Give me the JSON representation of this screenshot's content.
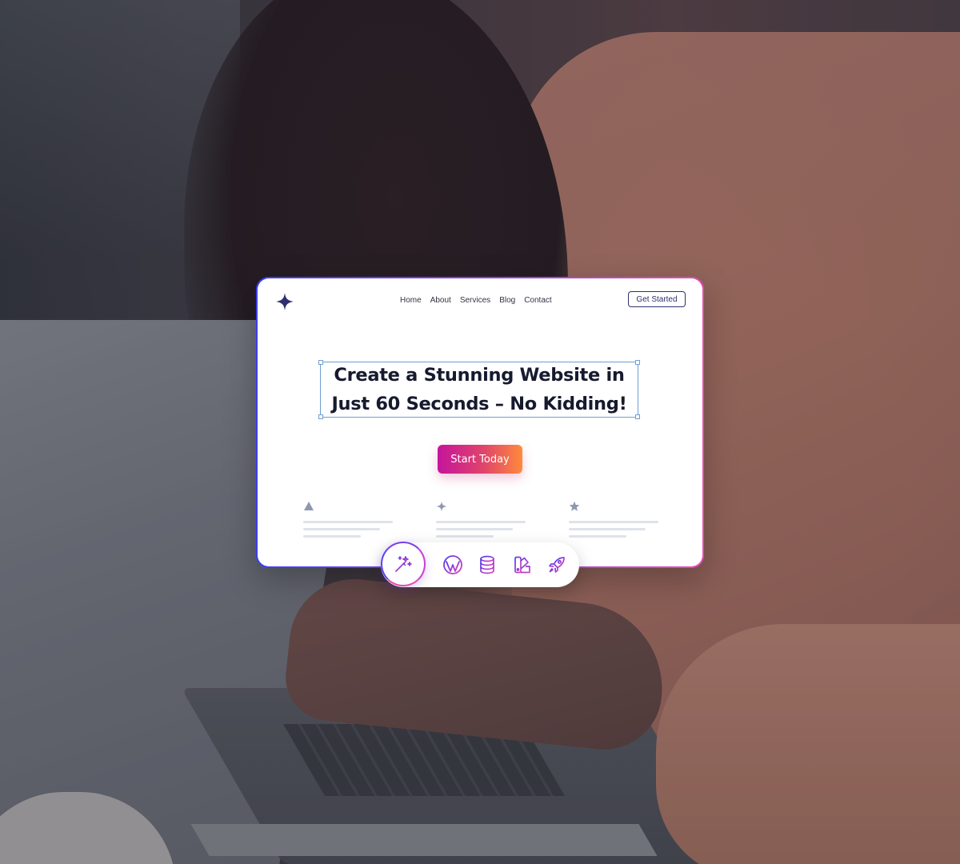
{
  "mockup": {
    "nav": {
      "items": [
        "Home",
        "About",
        "Services",
        "Blog",
        "Contact"
      ],
      "cta_label": "Get Started"
    },
    "hero": {
      "headline_line1": "Create a Stunning Website in",
      "headline_line2": "Just 60 Seconds – No Kidding!",
      "button_label": "Start Today"
    },
    "features": [
      {
        "icon": "triangle-icon"
      },
      {
        "icon": "sparkle-icon"
      },
      {
        "icon": "star-icon"
      }
    ]
  },
  "toolbar": {
    "tools": [
      "magic-wand-icon",
      "wordpress-icon",
      "database-icon",
      "color-swatch-icon",
      "rocket-icon"
    ]
  },
  "colors": {
    "accent_gradient_start": "#3b3ff0",
    "accent_gradient_end": "#e24fb6",
    "button_gradient_start": "#c5149c",
    "button_gradient_end": "#ff8a3c",
    "logo": "#2e2f70",
    "headline": "#161a2e"
  }
}
